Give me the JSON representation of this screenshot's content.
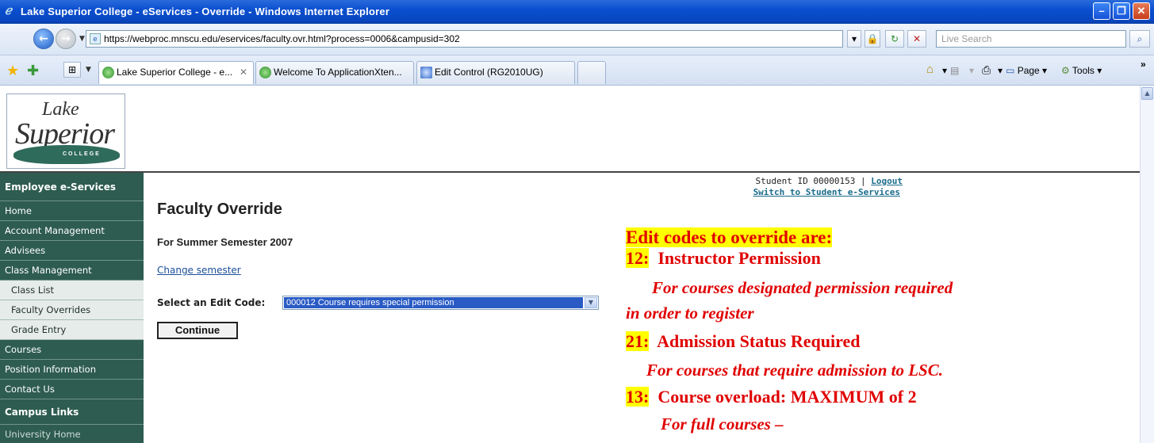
{
  "window": {
    "title": "Lake Superior College - eServices - Override - Windows Internet Explorer",
    "app_icon": "ie-icon",
    "controls": [
      "minimize",
      "maximize",
      "close"
    ]
  },
  "address_bar": {
    "url": "https://webproc.mnscu.edu/eservices/faculty.ovr.html?process=0006&campusid=302",
    "search_placeholder": "Live Search"
  },
  "tabs": [
    {
      "label": "Lake Superior College - e...",
      "active": true
    },
    {
      "label": "Welcome To ApplicationXten...",
      "active": false
    },
    {
      "label": "Edit Control (RG2010UG)",
      "active": false
    }
  ],
  "toolbar": {
    "page_label": "Page",
    "tools_label": "Tools"
  },
  "logo": {
    "line1": "Lake",
    "line2": "Superior",
    "line3": "COLLEGE"
  },
  "sidebar": {
    "heading": "Employee e-Services",
    "items": [
      {
        "label": "Home",
        "sub": false
      },
      {
        "label": "Account Management",
        "sub": false
      },
      {
        "label": "Advisees",
        "sub": false
      },
      {
        "label": "Class Management",
        "sub": false
      },
      {
        "label": "Class List",
        "sub": true
      },
      {
        "label": "Faculty Overrides",
        "sub": true
      },
      {
        "label": "Grade Entry",
        "sub": true
      },
      {
        "label": "Courses",
        "sub": false
      },
      {
        "label": "Position Information",
        "sub": false
      },
      {
        "label": "Contact Us",
        "sub": false
      }
    ],
    "campus_heading": "Campus Links",
    "campus_partial": "University Home"
  },
  "header_right": {
    "student_id": "Student ID 00000153 |",
    "logout": "Logout",
    "switch": "Switch to Student e-Services"
  },
  "main": {
    "title": "Faculty Override",
    "semester": "For Summer Semester 2007",
    "change_semester": "Change semester",
    "edit_code_label": "Select an Edit Code:",
    "edit_code_value": "000012 Course requires special permission",
    "continue": "Continue"
  },
  "annotation": {
    "heading": "Edit codes to override are:",
    "codes": [
      {
        "code": "12:",
        "title": "Instructor Permission",
        "note_lines": [
          "For courses designated permission required",
          "in order to register"
        ]
      },
      {
        "code": "21:",
        "title": "Admission Status Required",
        "note_lines": [
          "For courses that require admission to LSC."
        ]
      },
      {
        "code": "13:",
        "title": "Course overload: MAXIMUM of 2",
        "note_lines": [
          "For full courses –"
        ]
      }
    ]
  },
  "colors": {
    "sidebar_bg": "#2e5c50",
    "annotation_text": "#e00000",
    "annotation_highlight": "#ffff00",
    "select_highlight": "#2a5bc5"
  }
}
